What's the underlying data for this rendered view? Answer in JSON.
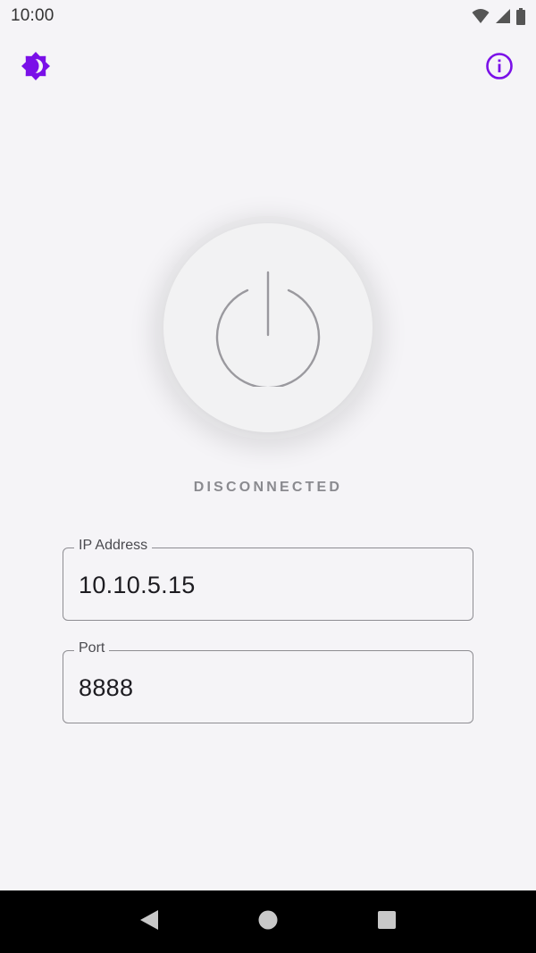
{
  "status_bar": {
    "time": "10:00",
    "icons": [
      "wifi-icon",
      "cell-signal-icon",
      "battery-icon"
    ]
  },
  "top_bar": {
    "theme_icon": "brightness-half-icon",
    "info_icon": "info-icon",
    "accent_color": "#7a10e8"
  },
  "connection": {
    "power_icon": "power-icon",
    "status": "DISCONNECTED"
  },
  "fields": {
    "ip_address": {
      "label": "IP Address",
      "value": "10.10.5.15"
    },
    "port": {
      "label": "Port",
      "value": "8888"
    }
  },
  "nav_bar": {
    "icons": [
      "back-icon",
      "home-icon",
      "recents-icon"
    ]
  }
}
